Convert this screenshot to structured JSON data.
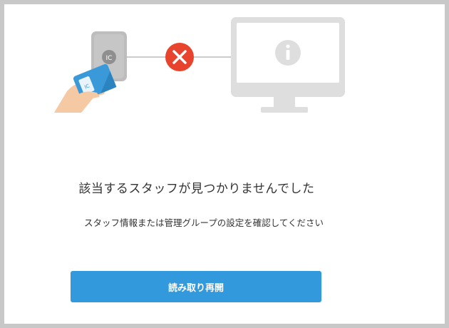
{
  "illustration": {
    "reader_label": "IC",
    "card_label": "IC",
    "error_icon": "x-icon",
    "monitor_icon": "info-icon"
  },
  "message": {
    "title": "該当するスタッフが見つかりませんでした",
    "subtitle": "スタッフ情報または管理グループの設定を確認してください"
  },
  "actions": {
    "retry_label": "読み取り再開"
  },
  "colors": {
    "accent": "#3399dd",
    "error": "#e8432c",
    "muted": "#d9d9d9"
  }
}
